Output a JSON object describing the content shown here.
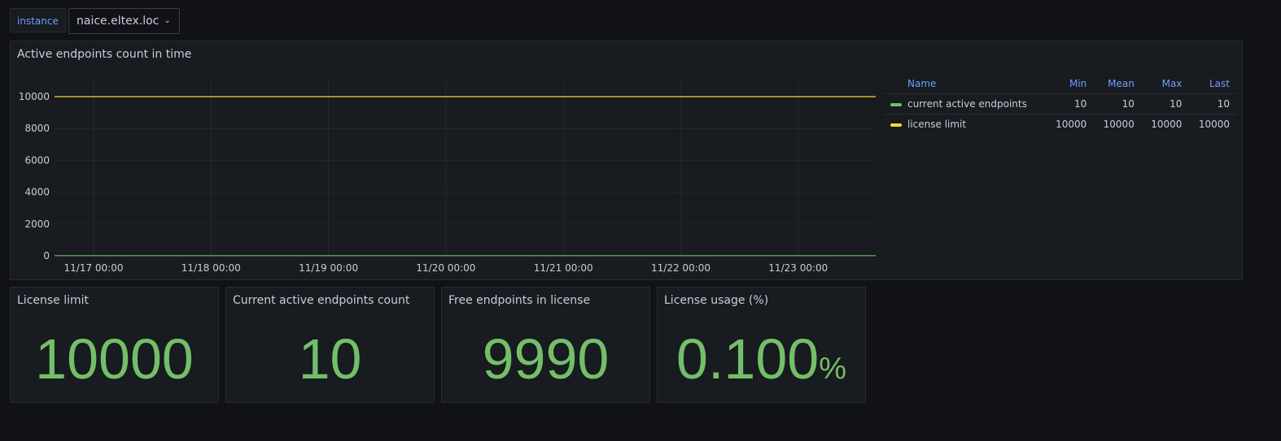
{
  "variables": {
    "instance_label": "instance",
    "instance_value": "naice.eltex.loc"
  },
  "timeseries_panel": {
    "title": "Active endpoints count in time",
    "legend": {
      "headers": {
        "name": "Name",
        "min": "Min",
        "mean": "Mean",
        "max": "Max",
        "last": "Last"
      },
      "rows": [
        {
          "name": "current active endpoints",
          "color": "#73bf69",
          "min": "10",
          "mean": "10",
          "max": "10",
          "last": "10"
        },
        {
          "name": "license limit",
          "color": "#fade2a",
          "min": "10000",
          "mean": "10000",
          "max": "10000",
          "last": "10000"
        }
      ]
    }
  },
  "chart_data": {
    "type": "line",
    "title": "Active endpoints count in time",
    "x_ticks": [
      "11/17 00:00",
      "11/18 00:00",
      "11/19 00:00",
      "11/20 00:00",
      "11/21 00:00",
      "11/22 00:00",
      "11/23 00:00"
    ],
    "y_ticks": [
      "0",
      "2000",
      "4000",
      "6000",
      "8000",
      "10000"
    ],
    "ylim": [
      0,
      10000
    ],
    "grid": true,
    "legend_position": "right",
    "series": [
      {
        "name": "current active endpoints",
        "color": "#73bf69",
        "values": [
          10,
          10,
          10,
          10,
          10,
          10,
          10
        ]
      },
      {
        "name": "license limit",
        "color": "#fade2a",
        "values": [
          10000,
          10000,
          10000,
          10000,
          10000,
          10000,
          10000
        ]
      }
    ]
  },
  "stats": [
    {
      "title": "License limit",
      "value": "10000",
      "unit": ""
    },
    {
      "title": "Current active endpoints count",
      "value": "10",
      "unit": ""
    },
    {
      "title": "Free endpoints in license",
      "value": "9990",
      "unit": ""
    },
    {
      "title": "License usage (%)",
      "value": "0.100",
      "unit": "%"
    }
  ]
}
